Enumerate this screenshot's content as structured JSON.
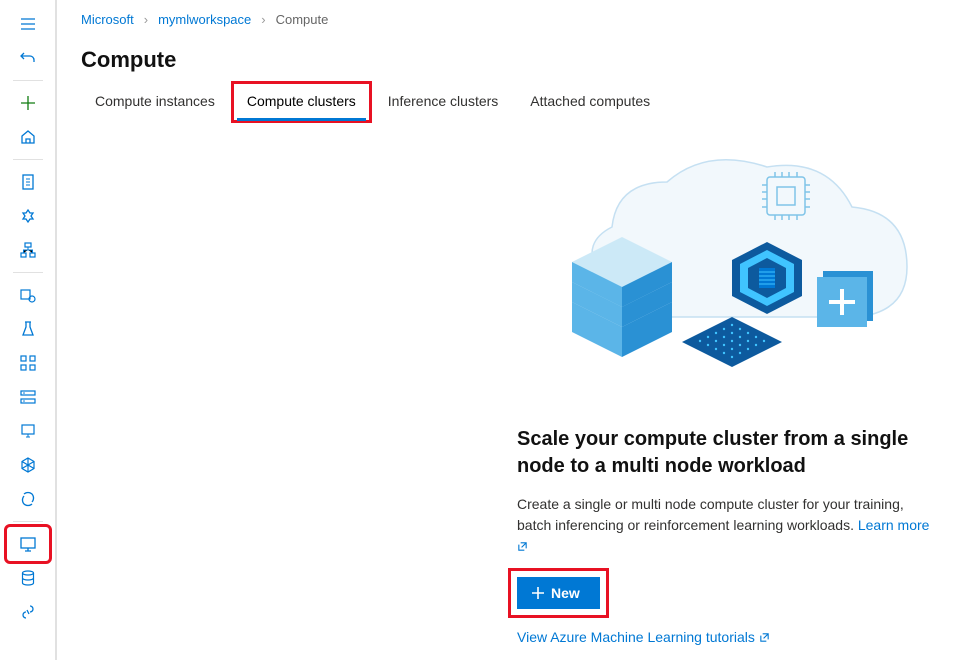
{
  "breadcrumb": {
    "items": [
      "Microsoft",
      "mymlworkspace",
      "Compute"
    ]
  },
  "page": {
    "title": "Compute"
  },
  "tabs": {
    "items": [
      {
        "label": "Compute instances",
        "active": false
      },
      {
        "label": "Compute clusters",
        "active": true
      },
      {
        "label": "Inference clusters",
        "active": false
      },
      {
        "label": "Attached computes",
        "active": false
      }
    ]
  },
  "empty_state": {
    "headline": "Scale your compute cluster from a single node to a multi node workload",
    "subtext": "Create a single or multi node compute cluster for your training, batch inferencing or reinforcement learning workloads.",
    "learn_more": "Learn more",
    "new_button": "New",
    "tutorials_link": "View Azure Machine Learning tutorials"
  },
  "sidebar": {
    "items": [
      "menu",
      "undo",
      "divider",
      "plus",
      "home",
      "divider",
      "notebook",
      "automate",
      "pipeline",
      "divider",
      "dataset",
      "experiment",
      "pipelines",
      "models",
      "endpoints",
      "env",
      "optimize",
      "divider",
      "compute",
      "datastores",
      "link"
    ]
  }
}
